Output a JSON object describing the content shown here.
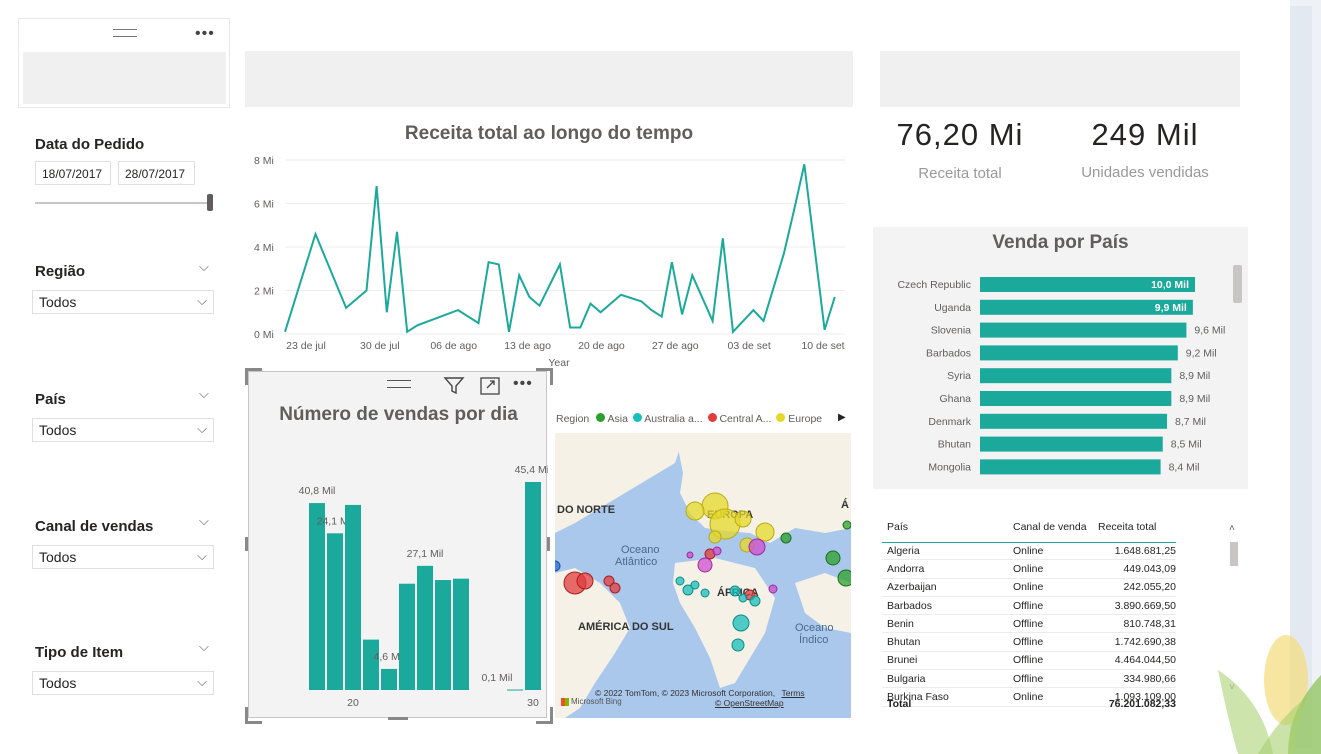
{
  "slicers": {
    "date": {
      "title": "Data do Pedido",
      "start": "18/07/2017",
      "end": "28/07/2017"
    },
    "regiao": {
      "title": "Região",
      "value": "Todos"
    },
    "pais": {
      "title": "País",
      "value": "Todos"
    },
    "canal": {
      "title": "Canal de vendas",
      "value": "Todos"
    },
    "tipo": {
      "title": "Tipo de Item",
      "value": "Todos"
    }
  },
  "line_chart": {
    "title": "Receita total ao longo do tempo",
    "xlabel": "Year",
    "y_ticks": [
      "8 Mi",
      "6 Mi",
      "4 Mi",
      "2 Mi",
      "0 Mi"
    ],
    "x_ticks": [
      "23 de jul",
      "30 de jul",
      "06 de ago",
      "13 de ago",
      "20 de ago",
      "27 de ago",
      "03 de set",
      "10 de set"
    ],
    "color": "#1aa99a"
  },
  "bar_chart": {
    "title": "Número de vendas por dia",
    "x_ticks": [
      "20",
      "30"
    ],
    "labels": [
      "40,8 Mil",
      "24,1 Mil",
      "4,6 Mil",
      "27,1 Mil",
      "0,1 Mil",
      "45,4 Mil"
    ],
    "color": "#1aa99a"
  },
  "map": {
    "legend_title": "Region",
    "legend": [
      {
        "name": "Asia",
        "color": "#2ca02c"
      },
      {
        "name": "Australia a...",
        "color": "#17bebb"
      },
      {
        "name": "Central A...",
        "color": "#e03c3c"
      },
      {
        "name": "Europe",
        "color": "#e6d82a"
      }
    ],
    "labels": [
      "DO NORTE",
      "EUROPA",
      "Oceano",
      "Atlântico",
      "ÁFRICA",
      "AMÉRICA DO SUL",
      "Oceano",
      "Índico"
    ],
    "attribution": "© 2022 TomTom, © 2023 Microsoft Corporation,",
    "terms": "Terms",
    "osm": "© OpenStreetMap",
    "bing": "Microsoft Bing"
  },
  "kpis": {
    "revenue": {
      "value": "76,20 Mi",
      "label": "Receita total"
    },
    "units": {
      "value": "249 Mil",
      "label": "Unidades vendidas"
    }
  },
  "country_chart": {
    "title": "Venda por País",
    "color": "#1aa99a"
  },
  "table": {
    "headers": [
      "País",
      "Canal de venda",
      "Receita total"
    ],
    "rows": [
      [
        "Algeria",
        "Online",
        "1.648.681,25"
      ],
      [
        "Andorra",
        "Online",
        "449.043,09"
      ],
      [
        "Azerbaijan",
        "Online",
        "242.055,20"
      ],
      [
        "Barbados",
        "Offline",
        "3.890.669,50"
      ],
      [
        "Benin",
        "Offline",
        "810.748,31"
      ],
      [
        "Bhutan",
        "Offline",
        "1.742.690,38"
      ],
      [
        "Brunei",
        "Offline",
        "4.464.044,50"
      ],
      [
        "Bulgaria",
        "Offline",
        "334.980,66"
      ],
      [
        "Burkina Faso",
        "Online",
        "1.093.109,00"
      ]
    ],
    "total_label": "Total",
    "total_value": "76.201.082,33"
  },
  "chart_data": [
    {
      "type": "line",
      "title": "Receita total ao longo do tempo",
      "xlabel": "Year",
      "x_range": [
        "2017-07-20",
        "2017-09-13"
      ],
      "ylim": [
        0,
        8000000
      ],
      "x": [
        "2017-07-20",
        "2017-07-23",
        "2017-07-26",
        "2017-07-28",
        "2017-07-29",
        "2017-07-30",
        "2017-07-31",
        "2017-08-01",
        "2017-08-02",
        "2017-08-06",
        "2017-08-08",
        "2017-08-09",
        "2017-08-10",
        "2017-08-11",
        "2017-08-12",
        "2017-08-13",
        "2017-08-14",
        "2017-08-16",
        "2017-08-17",
        "2017-08-18",
        "2017-08-19",
        "2017-08-20",
        "2017-08-22",
        "2017-08-24",
        "2017-08-25",
        "2017-08-26",
        "2017-08-27",
        "2017-08-28",
        "2017-08-29",
        "2017-08-31",
        "2017-09-01",
        "2017-09-02",
        "2017-09-04",
        "2017-09-05",
        "2017-09-07",
        "2017-09-08",
        "2017-09-09",
        "2017-09-11",
        "2017-09-12"
      ],
      "values": [
        100000,
        4600000,
        1200000,
        2000000,
        6800000,
        1000000,
        4700000,
        100000,
        400000,
        1100000,
        500000,
        3300000,
        3200000,
        100000,
        2700000,
        1700000,
        1300000,
        3200000,
        300000,
        300000,
        1400000,
        1000000,
        1800000,
        1500000,
        1100000,
        800000,
        3300000,
        900000,
        2700000,
        600000,
        4400000,
        100000,
        1100000,
        600000,
        3700000,
        5700000,
        7800000,
        200000,
        1700000
      ]
    },
    {
      "type": "bar",
      "title": "Número de vendas por dia",
      "x": [
        18,
        19,
        20,
        21,
        22,
        23,
        24,
        25,
        26,
        27,
        28,
        29,
        30
      ],
      "values": [
        40800,
        34200,
        40400,
        11000,
        4600,
        23200,
        27100,
        24000,
        24300,
        0,
        0,
        100,
        45400
      ],
      "data_labels": {
        "18": "40,8 Mil",
        "19": "24,1 Mil",
        "22": "4,6 Mil",
        "24": "27,1 Mil",
        "28": "0,1 Mil",
        "30": "45,4 Mil"
      }
    },
    {
      "type": "bar",
      "orientation": "horizontal",
      "title": "Venda por País",
      "categories": [
        "Czech Republic",
        "Uganda",
        "Slovenia",
        "Barbados",
        "Syria",
        "Ghana",
        "Denmark",
        "Bhutan",
        "Mongolia"
      ],
      "values": [
        10.0,
        9.9,
        9.6,
        9.2,
        8.9,
        8.9,
        8.7,
        8.5,
        8.4
      ],
      "value_labels": [
        "10,0 Mil",
        "9,9 Mil",
        "9,6 Mil",
        "9,2 Mil",
        "8,9 Mil",
        "8,9 Mil",
        "8,7 Mil",
        "8,5 Mil",
        "8,4 Mil"
      ],
      "unit": "Mil"
    }
  ]
}
